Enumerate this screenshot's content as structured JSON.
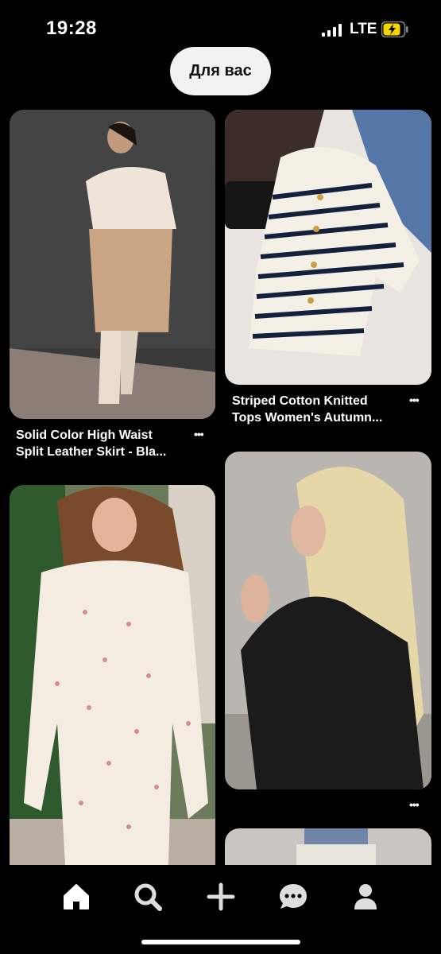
{
  "status": {
    "time": "19:28",
    "network": "LTE"
  },
  "header": {
    "tab_label": "Для вас"
  },
  "pins": [
    {
      "line1": "Solid Color High Waist",
      "line2": "Split Leather Skirt - Bla..."
    },
    {
      "line1": "Striped Cotton Knitted",
      "line2": "Tops Women's Autumn..."
    }
  ],
  "more_label": "•••",
  "icons": {
    "home": "home-icon",
    "search": "search-icon",
    "create": "plus-icon",
    "messages": "chat-bubble-icon",
    "profile": "profile-icon"
  },
  "colors": {
    "background": "#000000",
    "pill": "#f2f2f2",
    "battery": "#f5d400"
  }
}
